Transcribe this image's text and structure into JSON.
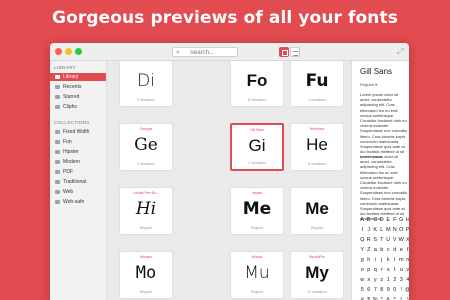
{
  "hero": {
    "title": "Gorgeous previews of all your fonts"
  },
  "toolbar": {
    "search_placeholder": "Search..."
  },
  "sidebar": {
    "library_heading": "LIBRARY",
    "library_items": [
      {
        "label": "Library",
        "selected": true
      },
      {
        "label": "Recents",
        "selected": false
      },
      {
        "label": "Starred",
        "selected": false
      },
      {
        "label": "Cliphs",
        "selected": false
      }
    ],
    "collections_heading": "COLLECTIONS",
    "collection_items": [
      {
        "label": "Fixed Width"
      },
      {
        "label": "Fun"
      },
      {
        "label": "Hipster"
      },
      {
        "label": "Modern"
      },
      {
        "label": "PDF"
      },
      {
        "label": "Traditional"
      },
      {
        "label": "Web"
      },
      {
        "label": "Web-safe"
      }
    ]
  },
  "fonts": [
    {
      "name": "",
      "sample": "Di",
      "variations": "3 Variations",
      "selected": false
    },
    {
      "name": "",
      "sample": "Fo",
      "variations": "8 Variations",
      "selected": false
    },
    {
      "name": "",
      "sample": "Fu",
      "variations": "4 Variations",
      "selected": false
    },
    {
      "name": "Georgia",
      "sample": "Ge",
      "variations": "4 Variations",
      "selected": false
    },
    {
      "name": "Gill Sans",
      "sample": "Gi",
      "variations": "2 Variations",
      "selected": true
    },
    {
      "name": "Helvetica",
      "sample": "He",
      "variations": "8 Variations",
      "selected": false
    },
    {
      "name": "Lucida Pen Bo...",
      "sample": "Hi",
      "variations": "Regular",
      "selected": false
    },
    {
      "name": "Impact",
      "sample": "Me",
      "variations": "Regular",
      "selected": false
    },
    {
      "name": "",
      "sample": "Me",
      "variations": "Regular",
      "selected": false
    },
    {
      "name": "Monaco",
      "sample": "Mo",
      "variations": "Regular",
      "selected": false
    },
    {
      "name": "Mucha",
      "sample": "Mu",
      "variations": "Regular",
      "selected": false
    },
    {
      "name": "MyriadPro",
      "sample": "My",
      "variations": "10 Variations",
      "selected": false
    }
  ],
  "detail": {
    "title": "Gill Sans",
    "style_select": "Regular",
    "paragraph_1": "Lorem ipsum dolor sit amet, consectetur adipiscing elit. Cras bibendum leo eu erat cursus scelerisque. Curabitur tincidunt nibh eu viverra molestie. Suspendisse non convallis libero. Cras lobortis turpis commodo malesuada. Suspendisse quis ante at dui facilisis eleifend ut sit amet massa.",
    "paragraph_2": "Lorem ipsum dolor sit amet, consectetur adipiscing elit. Cras bibendum leo eu erat cursus scelerisque. Curabitur tincidunt nibh eu viverra molestie. Suspendisse non convallis libero. Cras lobortis turpis commodo malesuada. Suspendisse quis ante at dui facilisis eleifend ut sit amet massa.",
    "glyphs": [
      "A",
      "B",
      "C",
      "D",
      "E",
      "F",
      "G",
      "H",
      "I",
      "J",
      "K",
      "L",
      "M",
      "N",
      "O",
      "P",
      "Q",
      "R",
      "S",
      "T",
      "U",
      "V",
      "W",
      "X",
      "Y",
      "Z",
      "a",
      "b",
      "c",
      "d",
      "e",
      "f",
      "g",
      "h",
      "i",
      "j",
      "k",
      "l",
      "m",
      "n",
      "o",
      "p",
      "q",
      "r",
      "s",
      "t",
      "u",
      "v",
      "w",
      "x",
      "y",
      "z",
      "1",
      "2",
      "3",
      "4",
      "5",
      "6",
      "7",
      "8",
      "9",
      "0",
      "!",
      "@",
      "#",
      "$",
      "%",
      "^",
      "&",
      "*",
      "(",
      ")",
      "£",
      "¢",
      "€",
      "¥"
    ]
  },
  "colors": {
    "accent": "#e24b4f"
  }
}
